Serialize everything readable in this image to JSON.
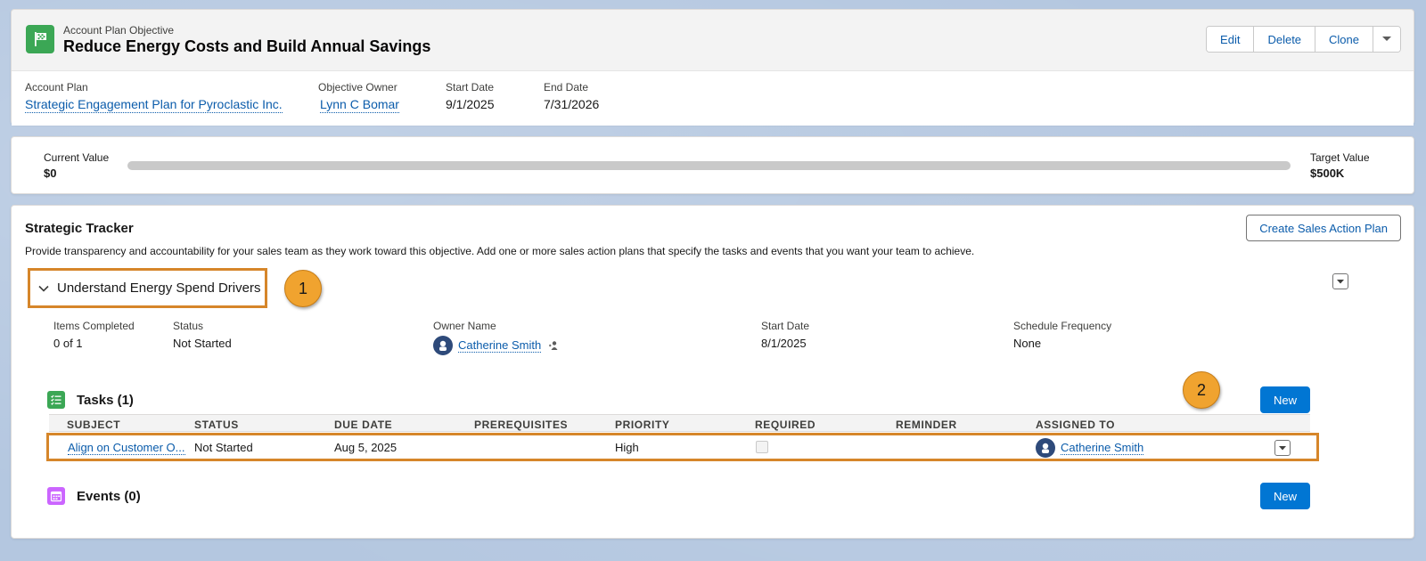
{
  "header": {
    "object_type": "Account Plan Objective",
    "title": "Reduce Energy Costs and Build Annual Savings",
    "actions": {
      "edit": "Edit",
      "delete": "Delete",
      "clone": "Clone"
    },
    "fields": {
      "account_plan_label": "Account Plan",
      "account_plan_value": "Strategic Engagement Plan for Pyroclastic Inc.",
      "owner_label": "Objective Owner",
      "owner_value": "Lynn C Bomar",
      "start_label": "Start Date",
      "start_value": "9/1/2025",
      "end_label": "End Date",
      "end_value": "7/31/2026"
    }
  },
  "progress": {
    "current_label": "Current Value",
    "current_value": "$0",
    "target_label": "Target Value",
    "target_value": "$500K",
    "fraction": 0
  },
  "tracker": {
    "title": "Strategic Tracker",
    "description": "Provide transparency and accountability for your sales team as they work toward this objective. Add one or more sales action plans that specify the tasks and events that you want your team to achieve.",
    "create_button": "Create Sales Action Plan",
    "plan": {
      "name": "Understand Energy Spend Drivers",
      "items_completed_label": "Items Completed",
      "items_completed_value": "0 of 1",
      "status_label": "Status",
      "status_value": "Not Started",
      "owner_label": "Owner Name",
      "owner_value": "Catherine Smith",
      "start_label": "Start Date",
      "start_value": "8/1/2025",
      "frequency_label": "Schedule Frequency",
      "frequency_value": "None"
    },
    "tasks": {
      "title": "Tasks (1)",
      "new_button": "New",
      "columns": [
        "SUBJECT",
        "STATUS",
        "DUE DATE",
        "PREREQUISITES",
        "PRIORITY",
        "REQUIRED",
        "REMINDER",
        "ASSIGNED TO"
      ],
      "rows": [
        {
          "subject": "Align on Customer O...",
          "status": "Not Started",
          "due_date": "Aug 5, 2025",
          "prerequisites": "",
          "priority": "High",
          "required": false,
          "reminder": "",
          "assigned_to": "Catherine Smith"
        }
      ]
    },
    "events": {
      "title": "Events (0)",
      "new_button": "New"
    }
  },
  "callouts": [
    "1",
    "2"
  ],
  "colors": {
    "brand_blue": "#0176d3",
    "link_blue": "#0b5cab",
    "objective_icon_green": "#3ba755",
    "task_icon_green": "#3ba755",
    "event_icon_purple": "#cb65ff",
    "callout_orange": "#f0a32f",
    "highlight_border": "#d6862a"
  },
  "icons": [
    "objective-flag-icon",
    "chevron-down-icon",
    "user-avatar-icon",
    "change-owner-icon",
    "task-list-icon",
    "calendar-icon"
  ]
}
